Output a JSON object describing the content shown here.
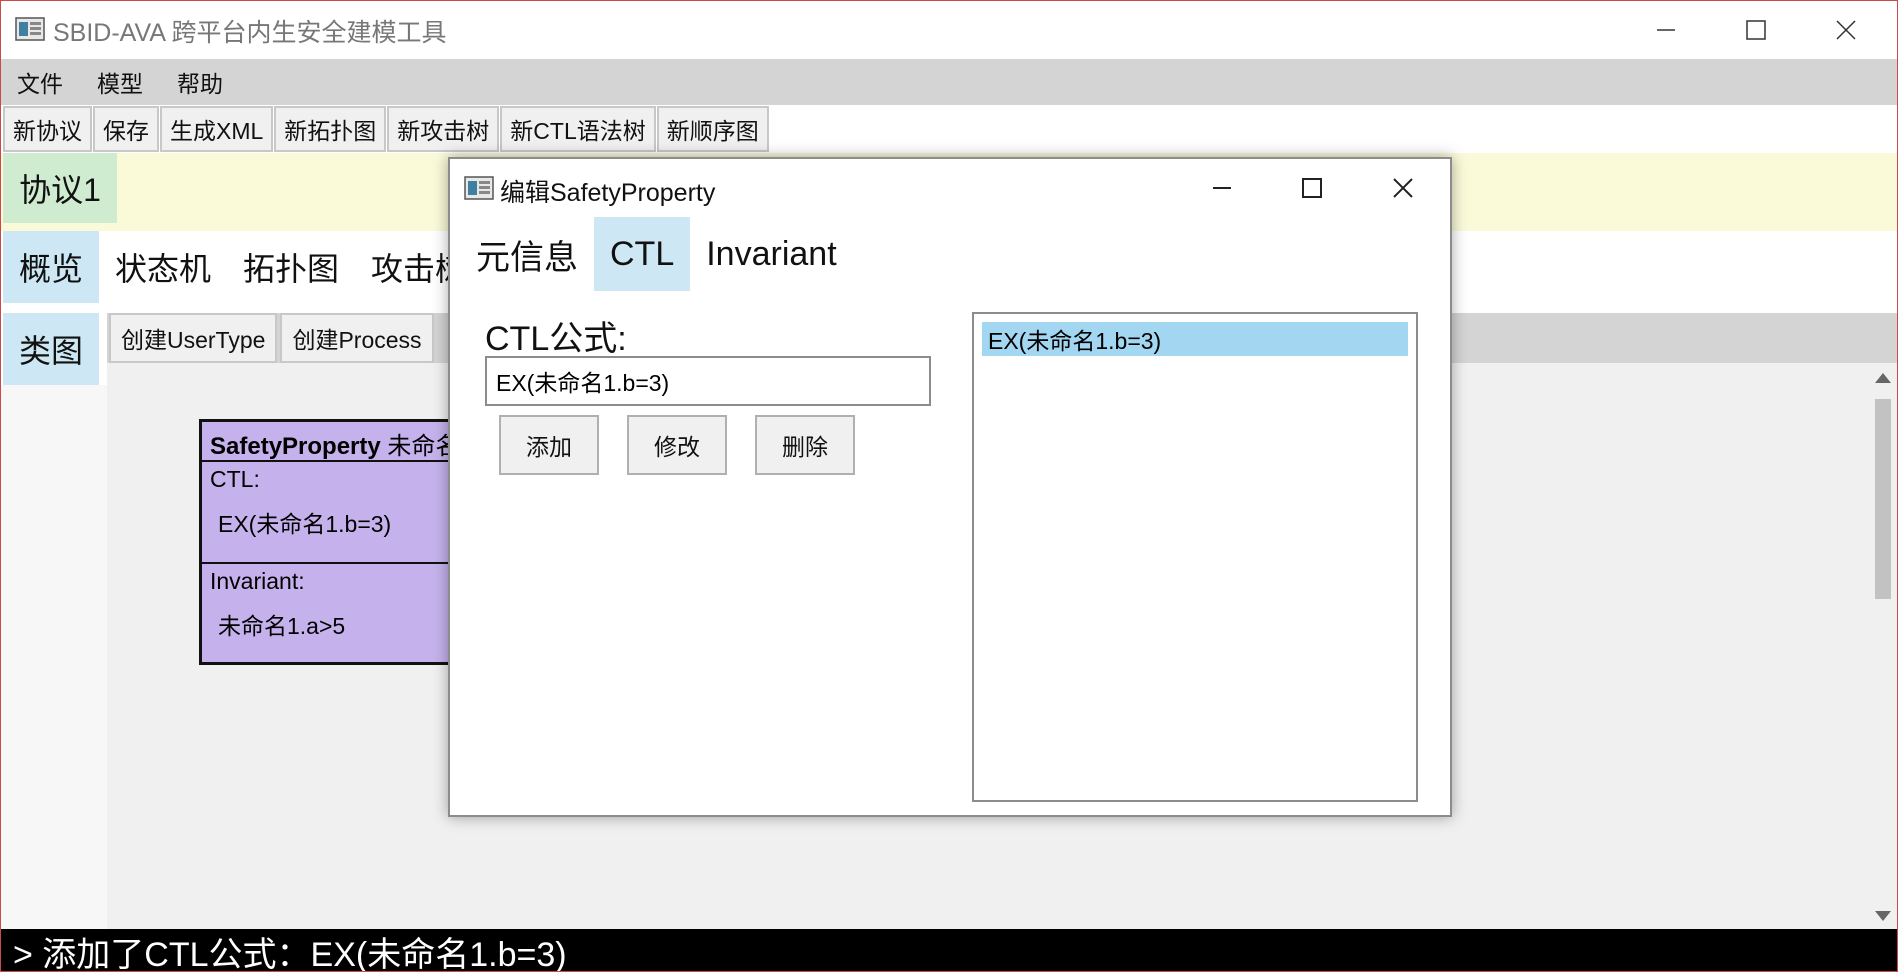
{
  "window": {
    "title": "SBID-AVA 跨平台内生安全建模工具"
  },
  "menu": [
    "文件",
    "模型",
    "帮助"
  ],
  "toolbar": [
    "新协议",
    "保存",
    "生成XML",
    "新拓扑图",
    "新攻击树",
    "新CTL语法树",
    "新顺序图"
  ],
  "protocol_tab": "协议1",
  "view_tabs": [
    "概览",
    "状态机",
    "拓扑图",
    "攻击树"
  ],
  "class_tab": "类图",
  "canvas_toolbar": [
    "创建UserType",
    "创建Process"
  ],
  "node": {
    "title_bold": "SafetyProperty",
    "title_rest": "未命名",
    "ctl_label": "CTL:",
    "ctl_value": "EX(未命名1.b=3)",
    "inv_label": "Invariant:",
    "inv_value": "未命名1.a>5"
  },
  "dialog": {
    "title": "编辑SafetyProperty",
    "tabs": [
      "元信息",
      "CTL",
      "Invariant"
    ],
    "active_tab": "CTL",
    "ctl_label": "CTL公式:",
    "ctl_input_value": "EX(未命名1.b=3)",
    "buttons": {
      "add": "添加",
      "edit": "修改",
      "delete": "删除"
    },
    "list_items": [
      "EX(未命名1.b=3)"
    ]
  },
  "console": {
    "text": "> 添加了CTL公式：EX(未命名1.b=3)"
  },
  "icons": {
    "app": "app-window-icon",
    "minimize": "minimize-icon",
    "maximize": "maximize-icon",
    "close": "close-icon"
  },
  "colors": {
    "menubar_bg": "#d4d4d4",
    "protocol_band": "#fafad9",
    "protocol_tab": "#d0ecd0",
    "active_tab": "#cde8f4",
    "node_fill": "#c5b2ec",
    "list_selection": "#a3d6f0",
    "console_bg": "#000000"
  }
}
